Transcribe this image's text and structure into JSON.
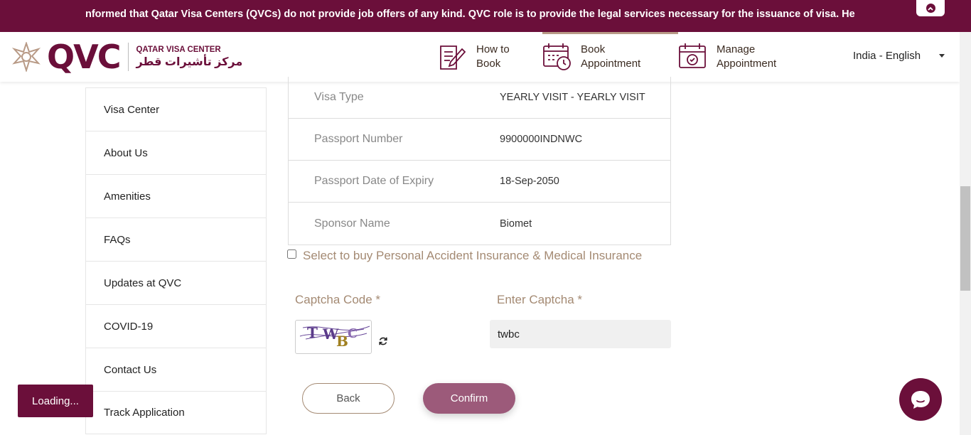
{
  "ticker": {
    "text": "nformed that Qatar Visa Centers (QVCs) do not provide job offers of any kind. QVC role is to provide the legal services necessary for the issuance of visa. He"
  },
  "logo": {
    "brand": "QVC",
    "name_en": "QATAR VISA CENTER",
    "name_ar": "مركز تأشيرات قطر"
  },
  "nav": {
    "items": [
      {
        "line1": "How to",
        "line2": "Book",
        "icon": "document-pen-icon"
      },
      {
        "line1": "Book",
        "line2": "Appointment",
        "icon": "calendar-clock-icon"
      },
      {
        "line1": "Manage",
        "line2": "Appointment",
        "icon": "calendar-check-icon"
      }
    ],
    "language": "India - English"
  },
  "sidebar": {
    "items": [
      {
        "label": "Visa Center"
      },
      {
        "label": "About Us"
      },
      {
        "label": "Amenities"
      },
      {
        "label": "FAQs"
      },
      {
        "label": "Updates at QVC"
      },
      {
        "label": "COVID-19"
      },
      {
        "label": "Contact Us"
      },
      {
        "label": "Track Application"
      }
    ]
  },
  "details": {
    "rows": [
      {
        "key": "Visa Type",
        "value": "YEARLY VISIT - YEARLY VISIT"
      },
      {
        "key": "Passport Number",
        "value": "9900000INDNWC"
      },
      {
        "key": "Passport Date of Expiry",
        "value": "18-Sep-2050"
      },
      {
        "key": "Sponsor Name",
        "value": "Biomet"
      }
    ]
  },
  "insurance": {
    "label": "Select to buy Personal Accident Insurance & Medical Insurance",
    "checked": false
  },
  "captcha": {
    "code_label": "Captcha Code *",
    "enter_label": "Enter Captcha *",
    "image_text": "TWBC",
    "input_value": "twbc"
  },
  "actions": {
    "back": "Back",
    "confirm": "Confirm"
  },
  "status": {
    "loading": "Loading..."
  },
  "colors": {
    "brand": "#6b0f3a",
    "accent": "#a48a73",
    "confirm": "#9c5a7a"
  }
}
